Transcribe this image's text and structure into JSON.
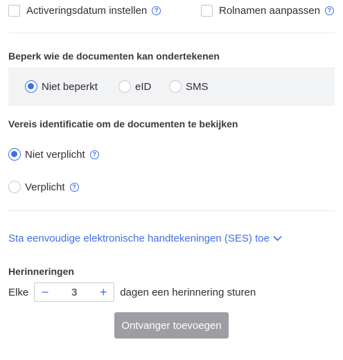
{
  "options": {
    "activation_label": "Activeringsdatum instellen",
    "rolenames_label": "Rolnamen aanpassen"
  },
  "restrict": {
    "title": "Beperk wie de documenten kan ondertekenen",
    "choices": [
      "Niet beperkt",
      "eID",
      "SMS"
    ],
    "selected": "Niet beperkt"
  },
  "identification": {
    "title": "Vereis identificatie om de documenten te bekijken",
    "choices": [
      "Niet verplicht",
      "Verplicht"
    ],
    "selected": "Niet verplicht"
  },
  "ses": {
    "link_label": "Sta eenvoudige elektronische handtekeningen (SES) toe"
  },
  "reminders": {
    "title": "Herinneringen",
    "prefix": "Elke",
    "value": "3",
    "minus": "−",
    "plus": "+",
    "suffix": "dagen een herinnering sturen"
  },
  "actions": {
    "add_recipient_label": "Ontvanger toevoegen"
  },
  "icons": {
    "help": "question-circle-icon",
    "chevron": "chevron-down-icon"
  },
  "colors": {
    "accent": "#3f6ee6",
    "panel_bg": "#f2f3f5",
    "button_disabled": "#9d9ea4"
  }
}
